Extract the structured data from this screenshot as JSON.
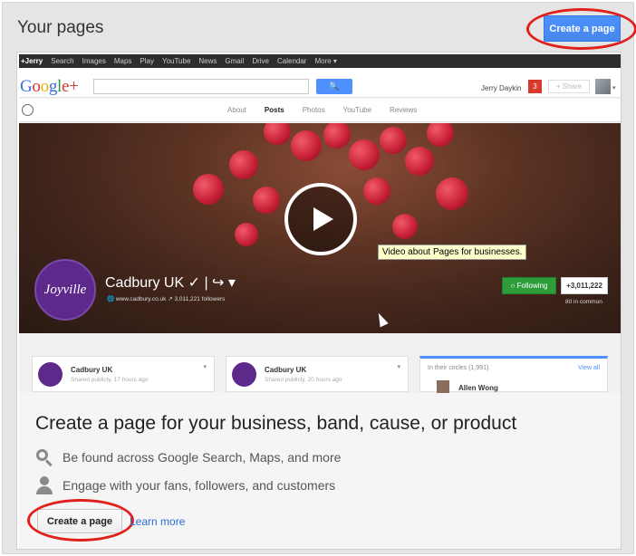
{
  "page": {
    "title": "Your pages",
    "top_button": "Create a page"
  },
  "screenshot": {
    "gbar": [
      "+Jerry",
      "Search",
      "Images",
      "Maps",
      "Play",
      "YouTube",
      "News",
      "Gmail",
      "Drive",
      "Calendar",
      "More ▾"
    ],
    "logo": {
      "g": "G",
      "o1": "o",
      "o2": "o",
      "g2": "g",
      "l": "l",
      "e": "e",
      "plus": "+"
    },
    "search_button": "🔍",
    "user_name": "Jerry Daykin",
    "notification_count": "3",
    "share_label": "+ Share",
    "tabs": [
      "About",
      "Posts",
      "Photos",
      "YouTube",
      "Reviews"
    ],
    "active_tab": "Posts",
    "brand_logo_text": "Joyville",
    "page_name": "Cadbury UK ✓ | ↪ ▾",
    "page_meta": "🌐 www.cadbury.co.uk   ↗ 3,011,221 followers",
    "tooltip": "Video about Pages for businesses.",
    "following_label": "○ Following",
    "plus_count": "+3,011,222",
    "in_common": "80 in common",
    "posts": [
      {
        "name": "Cadbury UK",
        "sub": "Shared publicly, 17 hours ago"
      },
      {
        "name": "Cadbury UK",
        "sub": "Shared publicly, 20 hours ago"
      }
    ],
    "circles": {
      "header": "In their circles (1,991)",
      "view_all": "View all",
      "person": "Allen Wong"
    }
  },
  "promo": {
    "headline": "Create a page for your business, band, cause, or product",
    "features": [
      "Be found across Google Search, Maps, and more",
      "Engage with your fans, followers, and customers"
    ],
    "button": "Create a page",
    "link": "Learn more"
  },
  "colors": {
    "accent_blue": "#4d90fe",
    "highlight_red": "#e0201c",
    "following_green": "#2f9c3a",
    "brand_purple": "#5d2a8c"
  }
}
